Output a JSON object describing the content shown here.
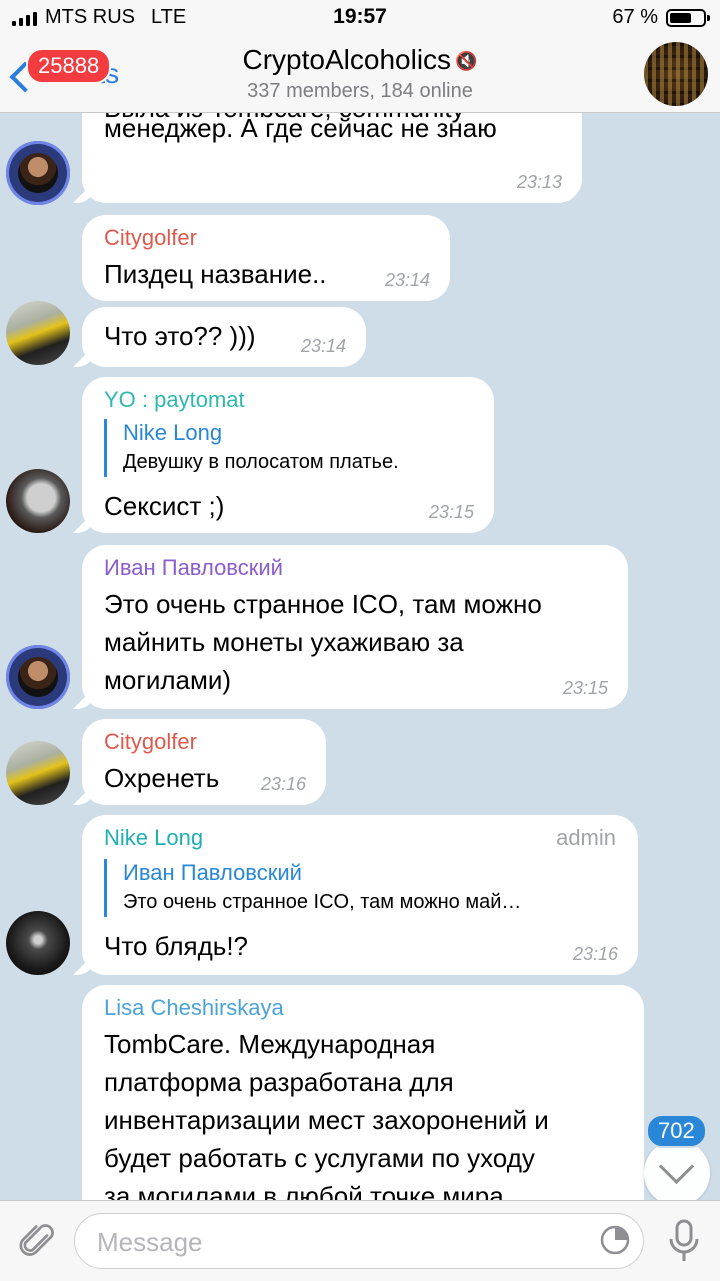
{
  "status_bar": {
    "carrier": "MTS RUS",
    "network": "LTE",
    "time": "19:57",
    "battery": "67 %",
    "battery_level": 0.67
  },
  "header": {
    "back_label": "Chats",
    "unread_badge": "25888",
    "title": "CryptoAlcoholics",
    "subtitle": "337 members, 184 online",
    "mute_icon": "muted-speaker-icon"
  },
  "messages": [
    {
      "lines": [
        "Была из Tombcare, community",
        "менеджер. А где сейчас не знаю"
      ],
      "time": "23:13"
    },
    {
      "sender": "Citygolfer",
      "sender_color": "#e0584c",
      "text": "Пиздец название..",
      "time": "23:14"
    },
    {
      "text": "Что это?? )))",
      "time": "23:14"
    },
    {
      "sender": "YO : paytomat",
      "sender_color": "#2eb8b0",
      "reply_name": "Nike Long",
      "reply_text": "Девушку в полосатом платье.",
      "text": "Сексист ;)",
      "time": "23:15"
    },
    {
      "sender": "Иван Павловский",
      "sender_color": "#8a5ccc",
      "lines": [
        "Это очень странное ICO, там можно",
        "майнить монеты ухаживаю за",
        "могилами)"
      ],
      "time": "23:15"
    },
    {
      "sender": "Citygolfer",
      "sender_color": "#e0584c",
      "text": "Охренеть",
      "time": "23:16"
    },
    {
      "sender": "Nike Long",
      "sender_color": "#1fb0b6",
      "admin": "admin",
      "reply_name": "Иван Павловский",
      "reply_text": "Это очень странное ICO, там можно май…",
      "text": "Что блядь!?",
      "time": "23:16"
    },
    {
      "sender": "Lisa Cheshirskaya",
      "sender_color": "#4aa3d8",
      "lines": [
        "TombCare. Международная",
        "платформа разработана для",
        "инвентаризации мест захоронений и",
        "будет работать с услугами по уходу",
        "за могилами в любой точке мира"
      ]
    }
  ],
  "scroll": {
    "unread_count": "702"
  },
  "input": {
    "placeholder": "Message"
  }
}
